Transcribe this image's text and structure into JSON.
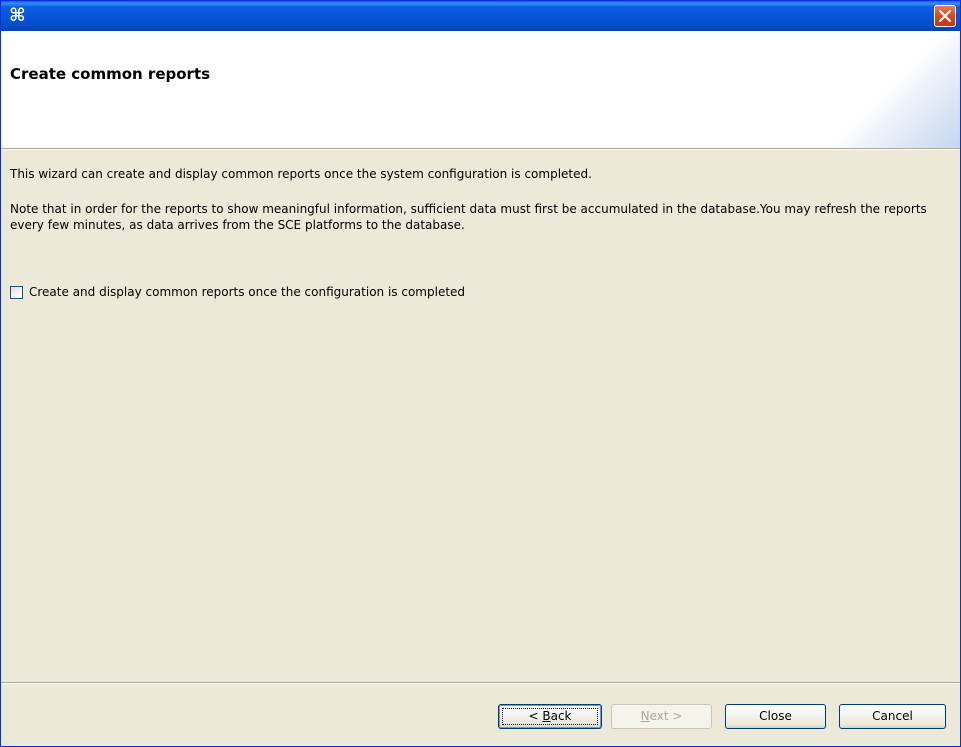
{
  "window": {
    "app_icon": "⌘",
    "app_icon_name": "app-icon",
    "close_icon_name": "close-icon"
  },
  "header": {
    "title": "Create common reports"
  },
  "content": {
    "paragraph1": "This wizard can create and display common reports once the system configuration is completed.",
    "paragraph2": "Note that in order for the reports to show meaningful information, sufficient data must first be accumulated in the database.You may refresh the reports every few minutes, as data arrives from the SCE platforms to the database.",
    "checkbox_label": "Create and display common reports once the configuration is completed",
    "checkbox_checked": false
  },
  "buttons": {
    "back_prefix": "< ",
    "back_mnemonic": "B",
    "back_rest": "ack",
    "next_mnemonic": "N",
    "next_rest": "ext >",
    "close_label": "Close",
    "cancel_label": "Cancel"
  },
  "colors": {
    "titlebar": "#0553d6",
    "dialog_background": "#ece9d8",
    "header_background": "#ffffff",
    "close_button": "#d9481d"
  }
}
